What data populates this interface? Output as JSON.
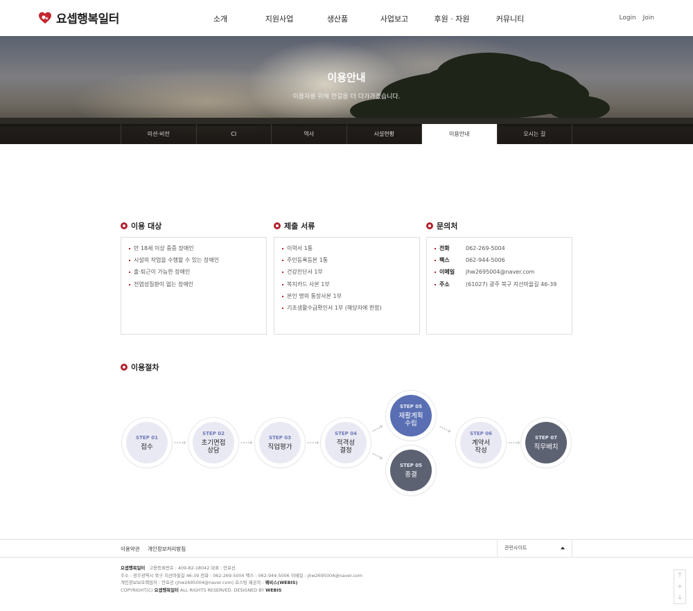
{
  "header": {
    "logo_text": "요셉행복일터",
    "nav": [
      "소개",
      "지원사업",
      "생산품",
      "사업보고",
      "후원 · 자원",
      "커뮤니티"
    ],
    "login": "Login",
    "join": "Join"
  },
  "hero": {
    "title": "이용안내",
    "subtitle": "이용자를 위해 한걸음 더 다가가겠습니다.",
    "tabs": [
      "미션·비전",
      "CI",
      "역사",
      "시설현황",
      "이용안내",
      "오시는 길"
    ],
    "active_tab": "이용안내"
  },
  "target": {
    "title": "이용 대상",
    "items": [
      "만 18세 이상 중증 장애인",
      "시설의 작업을 수행할 수 있는 장애인",
      "출·퇴근이 가능한 장애인",
      "전염성질환이 없는 장애인"
    ]
  },
  "documents": {
    "title": "제출 서류",
    "items": [
      "이력서 1통",
      "주민등록등본 1통",
      "건강진단서 1부",
      "복지카드 사본 1부",
      "본인 명의 통장사본 1부",
      "기초생활수급확인서 1부 (해당자에 한함)"
    ]
  },
  "contact": {
    "title": "문의처",
    "items": [
      {
        "label": "전화",
        "value": "062-269-5004"
      },
      {
        "label": "팩스",
        "value": "062-944-5006"
      },
      {
        "label": "이메일",
        "value": "jhw2695004@naver.com"
      },
      {
        "label": "주소",
        "value": "(61027) 광주 북구 지산마을길 46-39"
      }
    ]
  },
  "process": {
    "title": "이용절차",
    "steps": [
      {
        "label": "STEP 01",
        "name": "접수"
      },
      {
        "label": "STEP 02",
        "name": "초기면접 상담"
      },
      {
        "label": "STEP 03",
        "name": "직업평가"
      },
      {
        "label": "STEP 04",
        "name": "적격성 결정"
      },
      {
        "label": "STEP 05",
        "name": "재활계획 수립"
      },
      {
        "label": "STEP 05",
        "name": "종결"
      },
      {
        "label": "STEP 06",
        "name": "계약서 작성"
      },
      {
        "label": "STEP 07",
        "name": "직무배치"
      }
    ]
  },
  "footer": {
    "links": [
      "이용약관",
      "개인정보처리방침"
    ],
    "family_site": "관련사이트",
    "line1": {
      "org": "요셉행복일터",
      "rest": "고용등록번호 : 409-82-18042   대표 : 안효선"
    },
    "line2": "주소 : 광주광역시 북구 지산마을길 46-39   전화 : 062-269-5004   팩스 : 062-944-5006   이메일 : jhw2695004@naver.com",
    "line3": {
      "text": "개인정보보호책임자 : 안효선 (jhw2695004@naver.com)   호스팅 제공자 : ",
      "host": "웨비스(WEBIS)"
    },
    "line4": {
      "pre": "COPYRIGHT(C) ",
      "org": "요셉행복일터",
      "mid": " ALL RIGHTS RESERVED. DESIGNED BY ",
      "designer": "WEBIS"
    }
  },
  "colors": {
    "accent": "#b0222c",
    "step_blue": "#5a6fb3",
    "step_dark": "#5d6273",
    "step_light": "#e9e9f4"
  }
}
